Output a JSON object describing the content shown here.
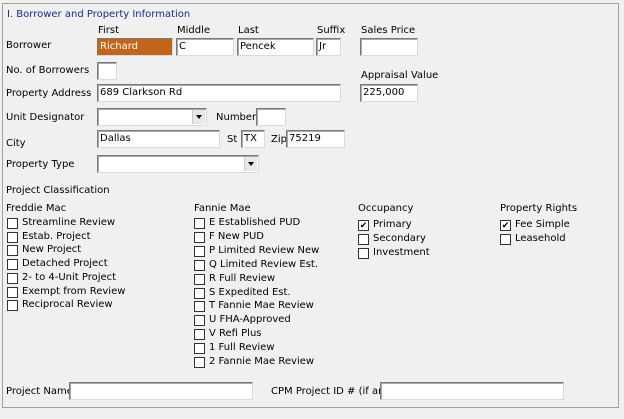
{
  "section_title": "I. Borrower and Property Information",
  "headers": {
    "first": "First",
    "middle": "Middle",
    "last": "Last",
    "suffix": "Suffix",
    "sales_price": "Sales Price"
  },
  "borrower": {
    "label": "Borrower",
    "first": "Richard",
    "middle": "C",
    "last": "Pencek",
    "suffix": "Jr"
  },
  "sales_price": "",
  "num_borrowers": {
    "label": "No. of Borrowers",
    "value": ""
  },
  "appraisal": {
    "label": "Appraisal Value",
    "value": "225,000"
  },
  "property_address": {
    "label": "Property Address",
    "value": "689 Clarkson Rd"
  },
  "unit_designator": {
    "label": "Unit Designator",
    "value": ""
  },
  "number": {
    "label": "Number",
    "value": ""
  },
  "city": {
    "label": "City",
    "value": "Dallas"
  },
  "st": {
    "label": "St",
    "value": "TX"
  },
  "zip": {
    "label": "Zip",
    "value": "75219"
  },
  "property_type": {
    "label": "Property Type",
    "value": ""
  },
  "project_classification": "Project Classification",
  "freddie_mac": {
    "title": "Freddie Mac",
    "items": [
      {
        "label": "Streamline Review",
        "checked": false
      },
      {
        "label": "Estab. Project",
        "checked": false
      },
      {
        "label": "New Project",
        "checked": false
      },
      {
        "label": "Detached Project",
        "checked": false
      },
      {
        "label": "2- to 4-Unit Project",
        "checked": false
      },
      {
        "label": "Exempt from Review",
        "checked": false
      },
      {
        "label": "Reciprocal Review",
        "checked": false
      }
    ]
  },
  "fannie_mae": {
    "title": "Fannie Mae",
    "items": [
      {
        "label": "E Established PUD",
        "checked": false
      },
      {
        "label": "F New PUD",
        "checked": false
      },
      {
        "label": "P Limited Review New",
        "checked": false
      },
      {
        "label": "Q Limited Review Est.",
        "checked": false
      },
      {
        "label": "R Full Review",
        "checked": false
      },
      {
        "label": "S Expedited Est.",
        "checked": false
      },
      {
        "label": "T Fannie Mae Review",
        "checked": false
      },
      {
        "label": "U FHA-Approved",
        "checked": false
      },
      {
        "label": "V Refi Plus",
        "checked": false
      },
      {
        "label": "1 Full Review",
        "checked": false
      },
      {
        "label": "2 Fannie Mae Review",
        "checked": false
      }
    ]
  },
  "occupancy": {
    "title": "Occupancy",
    "items": [
      {
        "label": "Primary",
        "checked": true
      },
      {
        "label": "Secondary",
        "checked": false
      },
      {
        "label": "Investment",
        "checked": false
      }
    ]
  },
  "property_rights": {
    "title": "Property Rights",
    "items": [
      {
        "label": "Fee Simple",
        "checked": true
      },
      {
        "label": "Leasehold",
        "checked": false
      }
    ]
  },
  "project_name": {
    "label": "Project Name",
    "value": ""
  },
  "cpm_project_id": {
    "label": "CPM Project ID # (if any)",
    "value": ""
  }
}
